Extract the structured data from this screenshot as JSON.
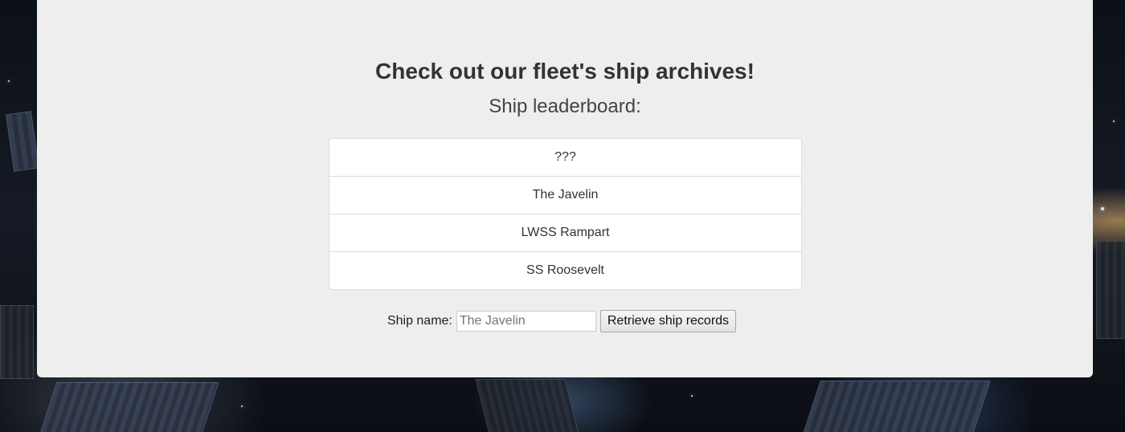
{
  "header": {
    "title": "Check out our fleet's ship archives!",
    "subtitle": "Ship leaderboard:"
  },
  "leaderboard": {
    "items": [
      {
        "label": "???"
      },
      {
        "label": "The Javelin"
      },
      {
        "label": "LWSS Rampart"
      },
      {
        "label": "SS Roosevelt"
      }
    ]
  },
  "form": {
    "label": "Ship name:",
    "placeholder": "The Javelin",
    "value": "",
    "button_label": "Retrieve ship records"
  },
  "colors": {
    "panel_background": "#eeeeee",
    "list_background": "#ffffff",
    "text": "#333333"
  }
}
